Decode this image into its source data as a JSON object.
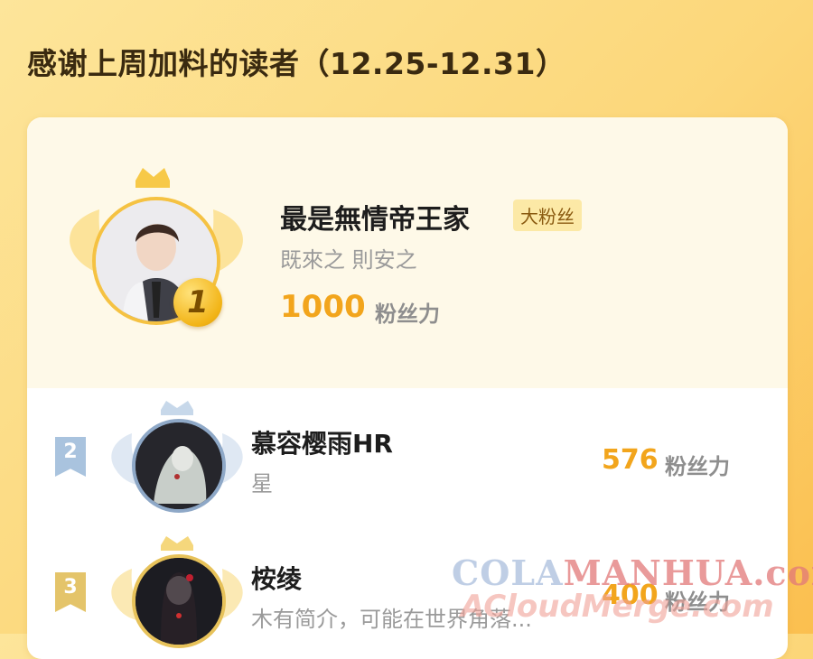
{
  "header": {
    "title": "感谢上周加料的读者（12.25-12.31）"
  },
  "top_reader": {
    "rank": "1",
    "name": "最是無情帝王家",
    "tag": "大粉丝",
    "bio": "既來之 則安之",
    "score": "1000",
    "unit": "粉丝力"
  },
  "readers": [
    {
      "rank": "2",
      "name": "慕容樱雨HR",
      "bio": "星",
      "score": "576",
      "unit": "粉丝力",
      "color": "#a9c3de"
    },
    {
      "rank": "3",
      "name": "桉绫",
      "bio": "木有简介，可能在世界角落...",
      "score": "400",
      "unit": "粉丝力",
      "color": "#e4c46a"
    }
  ],
  "watermark": {
    "text_a": "COLA",
    "text_b": "MANHUA.com",
    "text_c": "ACloudMerge.com"
  },
  "colors": {
    "accent": "#f2a51c",
    "background": "#fcd77a"
  }
}
